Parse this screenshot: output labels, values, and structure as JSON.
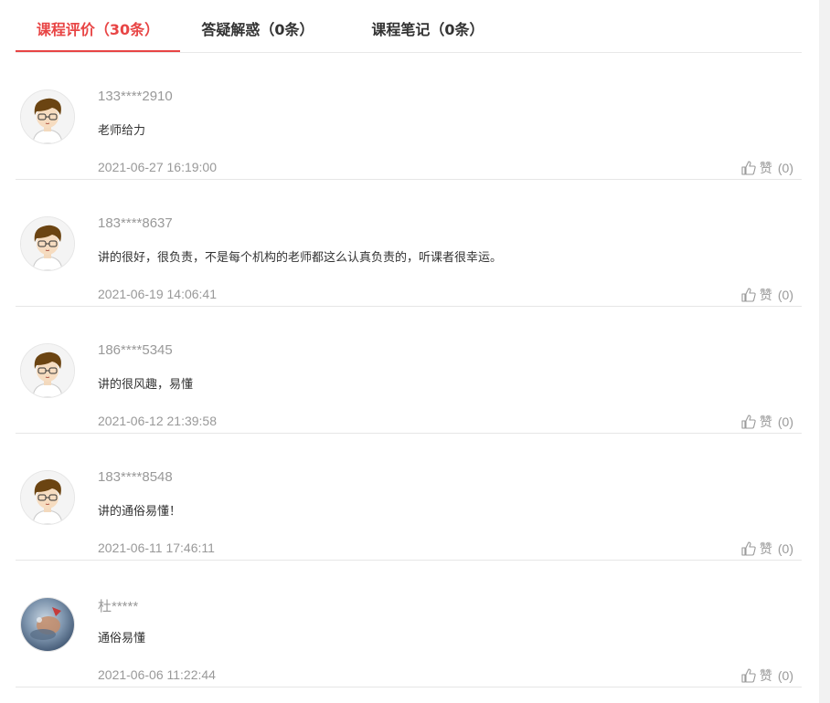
{
  "tabs": [
    {
      "label": "课程评价（30条）",
      "active": true
    },
    {
      "label": "答疑解惑（0条）",
      "active": false
    },
    {
      "label": "课程笔记（0条）",
      "active": false
    }
  ],
  "comments": [
    {
      "user": "133****2910",
      "content": "老师给力",
      "time": "2021-06-27 16:19:00",
      "like_label": "赞",
      "like_count": "(0)",
      "avatar": "cartoon-boy"
    },
    {
      "user": "183****8637",
      "content": "讲的很好，很负责，不是每个机构的老师都这么认真负责的，听课者很幸运。",
      "time": "2021-06-19 14:06:41",
      "like_label": "赞",
      "like_count": "(0)",
      "avatar": "cartoon-boy"
    },
    {
      "user": "186****5345",
      "content": "讲的很风趣，易懂",
      "time": "2021-06-12 21:39:58",
      "like_label": "赞",
      "like_count": "(0)",
      "avatar": "cartoon-boy"
    },
    {
      "user": "183****8548",
      "content": "讲的通俗易懂！",
      "time": "2021-06-11 17:46:11",
      "like_label": "赞",
      "like_count": "(0)",
      "avatar": "cartoon-boy"
    },
    {
      "user": "杜*****",
      "content": "通俗易懂",
      "time": "2021-06-06 11:22:44",
      "like_label": "赞",
      "like_count": "(0)",
      "avatar": "photo"
    }
  ],
  "colors": {
    "accent": "#e84545",
    "muted": "#999999",
    "text": "#333333"
  }
}
